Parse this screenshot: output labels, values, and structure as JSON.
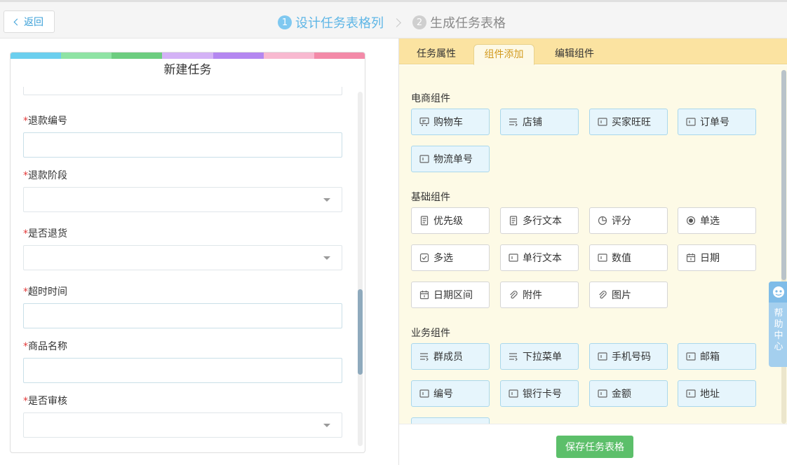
{
  "header": {
    "back_label": "返回",
    "steps": [
      {
        "num": "1",
        "label": "设计任务表格列",
        "state": "active"
      },
      {
        "num": "2",
        "label": "生成任务表格",
        "state": "inactive"
      }
    ]
  },
  "left_panel": {
    "title": "新建任务",
    "colorbar": [
      "#6ccfee",
      "#8fe3a4",
      "#6dcd80",
      "#d4b2f6",
      "#b487f0",
      "#f8b9d0",
      "#f38aa8"
    ],
    "fields": [
      {
        "label": "退款编号",
        "required_mark": "*",
        "type": "input",
        "value": ""
      },
      {
        "label": "退款阶段",
        "required_mark": "*",
        "type": "select",
        "value": ""
      },
      {
        "label": "是否退货",
        "required_mark": "*",
        "type": "select",
        "value": ""
      },
      {
        "label": "超时时间",
        "required_mark": "*",
        "type": "input",
        "value": ""
      },
      {
        "label": "商品名称",
        "required_mark": "*",
        "type": "input",
        "value": ""
      },
      {
        "label": "是否审核",
        "required_mark": "*",
        "type": "select",
        "value": ""
      }
    ]
  },
  "right_panel": {
    "tabs": [
      {
        "label": "任务属性",
        "active": false
      },
      {
        "label": "组件添加",
        "active": true
      },
      {
        "label": "编辑组件",
        "active": false
      }
    ],
    "sections": [
      {
        "title": "电商组件",
        "items": [
          {
            "label": "购物车",
            "icon": "cart-icon",
            "style": "blue"
          },
          {
            "label": "店铺",
            "icon": "list-icon",
            "style": "blue"
          },
          {
            "label": "买家旺旺",
            "icon": "text-field-icon",
            "style": "blue"
          },
          {
            "label": "订单号",
            "icon": "text-field-icon",
            "style": "blue"
          },
          {
            "label": "物流单号",
            "icon": "text-field-icon",
            "style": "blue"
          }
        ]
      },
      {
        "title": "基础组件",
        "items": [
          {
            "label": "优先级",
            "icon": "document-icon",
            "style": "white"
          },
          {
            "label": "多行文本",
            "icon": "document-icon",
            "style": "white"
          },
          {
            "label": "评分",
            "icon": "pie-icon",
            "style": "white"
          },
          {
            "label": "单选",
            "icon": "radio-icon",
            "style": "white"
          },
          {
            "label": "多选",
            "icon": "checkbox-icon",
            "style": "white"
          },
          {
            "label": "单行文本",
            "icon": "text-field-icon",
            "style": "white"
          },
          {
            "label": "数值",
            "icon": "text-field-icon",
            "style": "white"
          },
          {
            "label": "日期",
            "icon": "calendar-icon",
            "style": "white"
          },
          {
            "label": "日期区间",
            "icon": "calendar-icon",
            "style": "white"
          },
          {
            "label": "附件",
            "icon": "paperclip-icon",
            "style": "white"
          },
          {
            "label": "图片",
            "icon": "paperclip-icon",
            "style": "white"
          }
        ]
      },
      {
        "title": "业务组件",
        "items": [
          {
            "label": "群成员",
            "icon": "list-icon",
            "style": "blue"
          },
          {
            "label": "下拉菜单",
            "icon": "list-icon",
            "style": "blue"
          },
          {
            "label": "手机号码",
            "icon": "text-field-icon",
            "style": "blue"
          },
          {
            "label": "邮箱",
            "icon": "text-field-icon",
            "style": "blue"
          },
          {
            "label": "编号",
            "icon": "text-field-icon",
            "style": "blue"
          },
          {
            "label": "银行卡号",
            "icon": "text-field-icon",
            "style": "blue"
          },
          {
            "label": "金额",
            "icon": "text-field-icon",
            "style": "blue"
          },
          {
            "label": "地址",
            "icon": "text-field-icon",
            "style": "blue"
          },
          {
            "label": "",
            "icon": "",
            "style": "blue"
          }
        ]
      }
    ],
    "help_label": "帮助中心",
    "save_label": "保存任务表格"
  }
}
